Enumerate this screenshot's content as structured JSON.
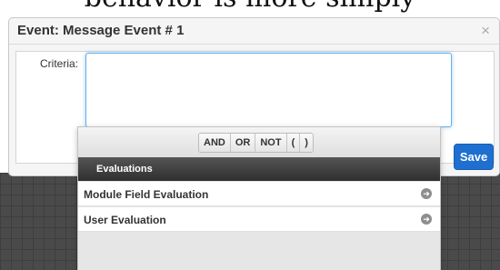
{
  "caption": {
    "text": "behavior is more simply"
  },
  "modal": {
    "title": "Event: Message Event # 1",
    "close_symbol": "×",
    "criteria_label": "Criteria:",
    "criteria_value": "",
    "save_label": "Save",
    "accent_color": "#1e6fd0"
  },
  "picker": {
    "operators": [
      "AND",
      "OR",
      "NOT",
      "(",
      ")"
    ],
    "section_label": "Evaluations",
    "items": [
      {
        "label": "Module Field Evaluation",
        "icon": "arrow-right-circle-icon"
      },
      {
        "label": "User Evaluation",
        "icon": "arrow-right-circle-icon"
      }
    ]
  }
}
